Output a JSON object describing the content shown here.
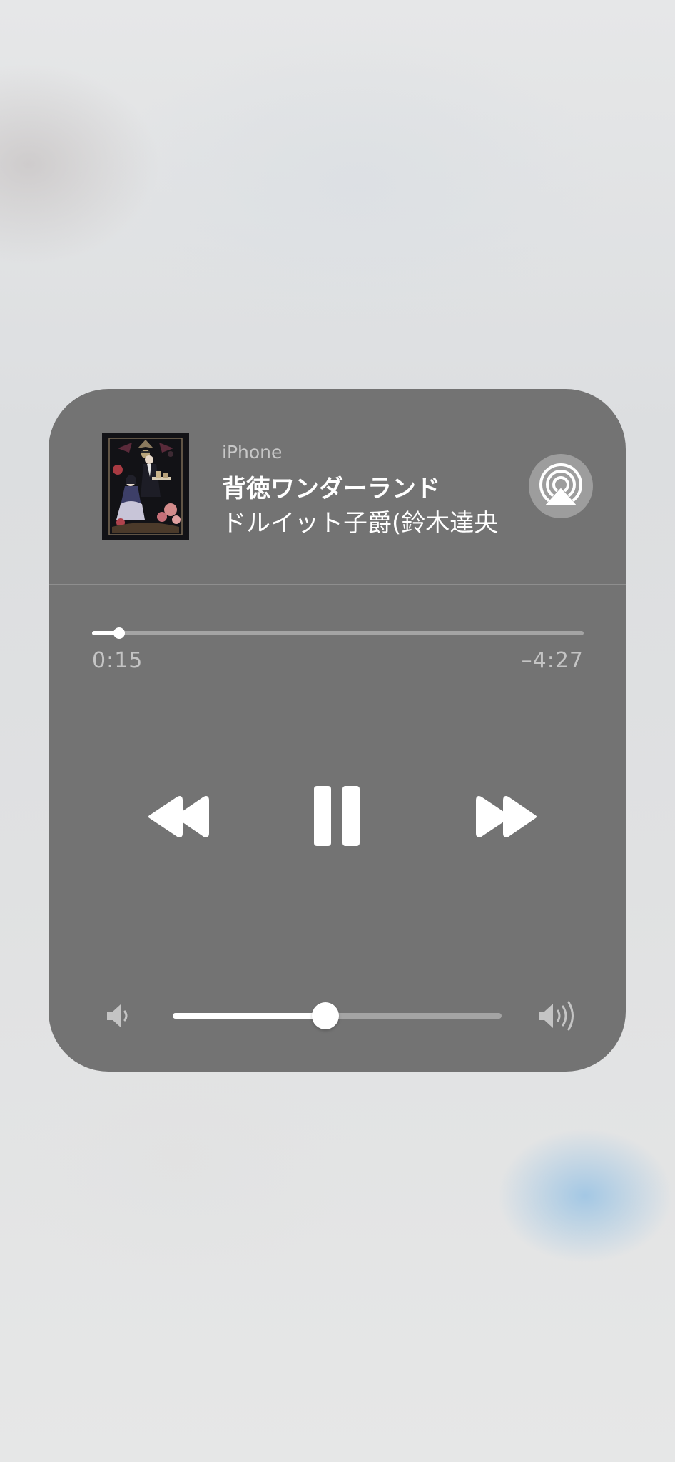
{
  "now_playing": {
    "device": "iPhone",
    "title": "背徳ワンダーランド",
    "artist": "ドルイット子爵(鈴木達央",
    "progress_fraction": 0.055
  },
  "times": {
    "elapsed": "0:15",
    "remaining": "–4:27"
  },
  "controls": {
    "rewind_icon": "backward-icon",
    "pause_icon": "pause-icon",
    "forward_icon": "forward-icon",
    "airplay_icon": "airplay-audio-icon"
  },
  "volume": {
    "level_fraction": 0.465,
    "low_icon": "speaker-low-icon",
    "high_icon": "speaker-high-icon"
  },
  "colors": {
    "card": "#737373",
    "accent": "#ffffff",
    "track": "#a4a4a4"
  }
}
